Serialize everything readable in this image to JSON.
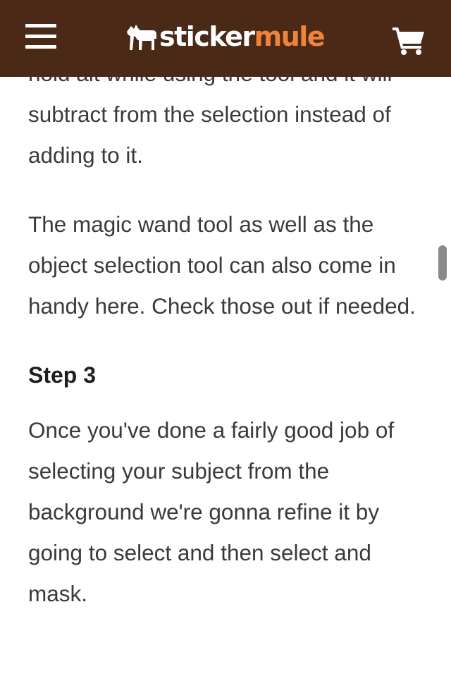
{
  "header": {
    "brand_part1": "sticker",
    "brand_part2": "mule",
    "icons": {
      "menu": "hamburger-menu-icon",
      "logo": "mule-logo-icon",
      "cart": "shopping-cart-icon"
    },
    "colors": {
      "background": "#4a2a17",
      "accent": "#f0833a",
      "text": "#ffffff"
    }
  },
  "article": {
    "para1": "hold alt while using the tool and it will subtract from the selection instead of adding to it.",
    "para2": "The magic wand tool as well as the object selection tool can also come in handy here. Check those out if needed.",
    "heading": "Step 3",
    "para3": "Once you've done a fairly good job of selecting your subject from the background we're gonna refine it by going to select and then select and mask."
  }
}
